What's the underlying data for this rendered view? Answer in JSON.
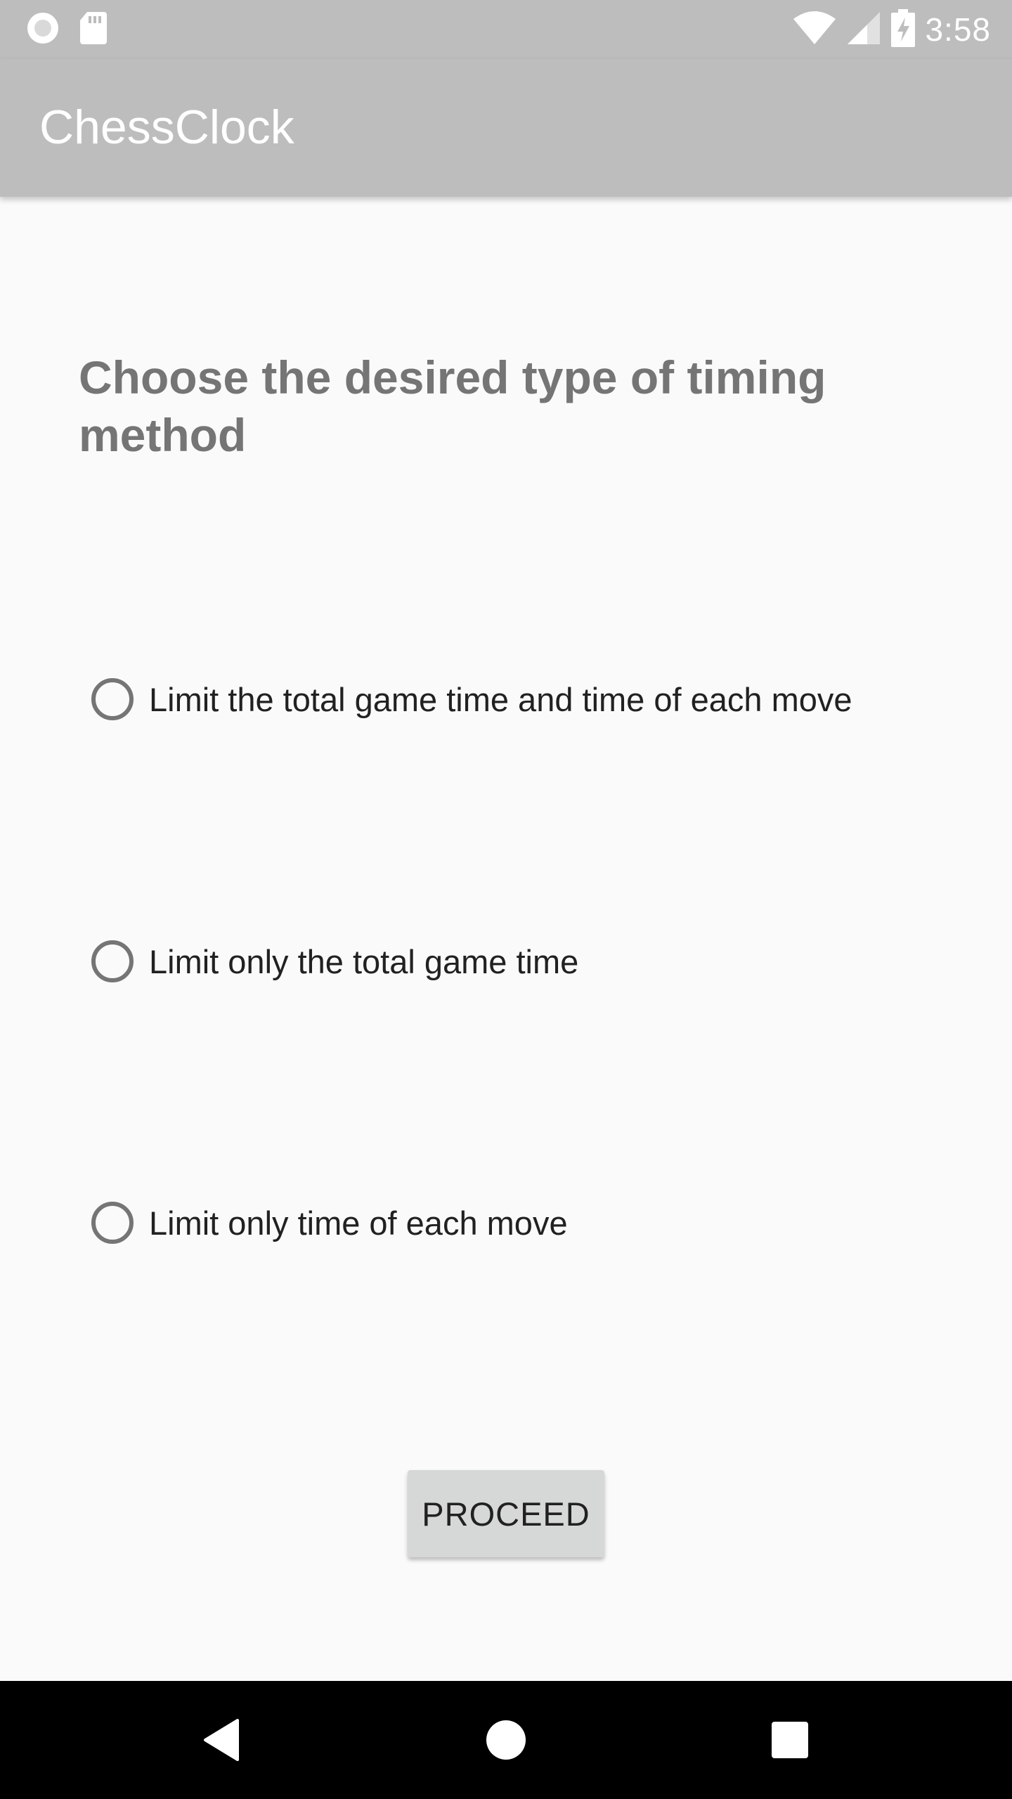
{
  "status_bar": {
    "time": "3:58",
    "icons": [
      "record-icon",
      "sd-card-icon",
      "wifi-icon",
      "cell-signal-icon",
      "battery-charging-icon"
    ]
  },
  "app_bar": {
    "title": "ChessClock"
  },
  "main": {
    "heading": "Choose the desired type of timing method",
    "options": [
      {
        "label": "Limit the total game time and time of each move",
        "selected": false
      },
      {
        "label": "Limit only the total game time",
        "selected": false
      },
      {
        "label": "Limit only time of each move",
        "selected": false
      }
    ],
    "proceed_label": "PROCEED"
  },
  "nav_bar": {
    "buttons": [
      "back-icon",
      "home-icon",
      "recents-icon"
    ]
  },
  "colors": {
    "app_bar": "#bdbdbd",
    "background": "#fafafa",
    "heading": "#757575",
    "radio": "#757575",
    "button": "#d6d7d7",
    "nav_bar": "#000000"
  }
}
